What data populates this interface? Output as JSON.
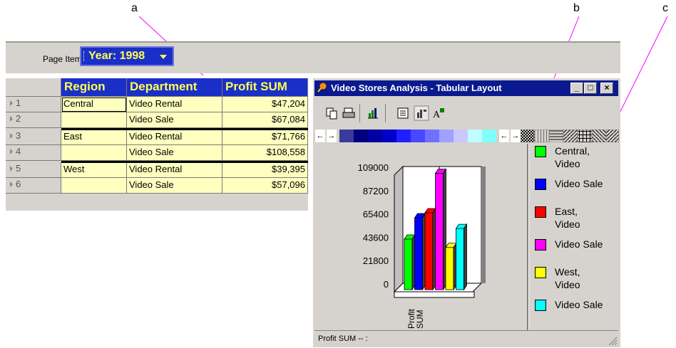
{
  "callouts": [
    "a",
    "b",
    "c"
  ],
  "page_items": {
    "label": "Page Items:",
    "year_dropdown": "Year: 1998"
  },
  "grid": {
    "headers": [
      "Region",
      "Department",
      "Profit SUM"
    ],
    "rows": [
      {
        "num": "1",
        "region": "Central",
        "department": "Video Rental",
        "profit": "$47,204"
      },
      {
        "num": "2",
        "region": "",
        "department": "Video Sale",
        "profit": "$67,084"
      },
      {
        "num": "3",
        "region": "East",
        "department": "Video Rental",
        "profit": "$71,766"
      },
      {
        "num": "4",
        "region": "",
        "department": "Video Sale",
        "profit": "$108,558"
      },
      {
        "num": "5",
        "region": "West",
        "department": "Video Rental",
        "profit": "$39,395"
      },
      {
        "num": "6",
        "region": "",
        "department": "Video Sale",
        "profit": "$57,096"
      }
    ]
  },
  "window": {
    "title": "Video Stores Analysis - Tabular Layout"
  },
  "toolbar_icons": [
    "copy-icon",
    "print-icon",
    "bar-chart-icon",
    "legend-toggle-icon",
    "chart-type-icon",
    "font-icon"
  ],
  "palette": [
    "#3a3a9a",
    "#000080",
    "#0000a0",
    "#0000c8",
    "#2020ff",
    "#4848ff",
    "#7070ff",
    "#a0a0ff",
    "#c8c8ff",
    "#c0ffff",
    "#80ffff"
  ],
  "chart_data": {
    "type": "bar",
    "ytick_labels": [
      "109000",
      "87200",
      "65400",
      "43600",
      "21800",
      "0"
    ],
    "ylim": [
      0,
      109000
    ],
    "category_label": "Profit SUM",
    "series": [
      {
        "name": "Central, Video Rental",
        "value": 47204,
        "color": "#00ff00"
      },
      {
        "name": "Central, Video Sale",
        "value": 67084,
        "color": "#0000ff"
      },
      {
        "name": "East, Video Rental",
        "value": 71766,
        "color": "#ff0000"
      },
      {
        "name": "East, Video Sale",
        "value": 108558,
        "color": "#ff00ff"
      },
      {
        "name": "West, Video Rental",
        "value": 39395,
        "color": "#ffff00"
      },
      {
        "name": "West, Video Sale",
        "value": 57096,
        "color": "#00ffff"
      }
    ]
  },
  "legend": [
    {
      "line1": "Central,",
      "line2": "Video",
      "line3": "Video Sale",
      "color_a": "#00ff00",
      "color_b": "#0000ff"
    },
    {
      "line1": "East,",
      "line2": "Video",
      "line3": "Video Sale",
      "color_a": "#ff0000",
      "color_b": "#ff00ff"
    },
    {
      "line1": "West,",
      "line2": "Video",
      "line3": "Video Sale",
      "color_a": "#ffff00",
      "color_b": "#00ffff"
    }
  ],
  "status": "Profit SUM -- :",
  "colors": {
    "header_bg": "#1a2fc8",
    "header_text": "#ffff50",
    "cell_bg": "#ffffc0",
    "title_bar": "#0a1a8e",
    "callout_line": "#ff00ff"
  }
}
